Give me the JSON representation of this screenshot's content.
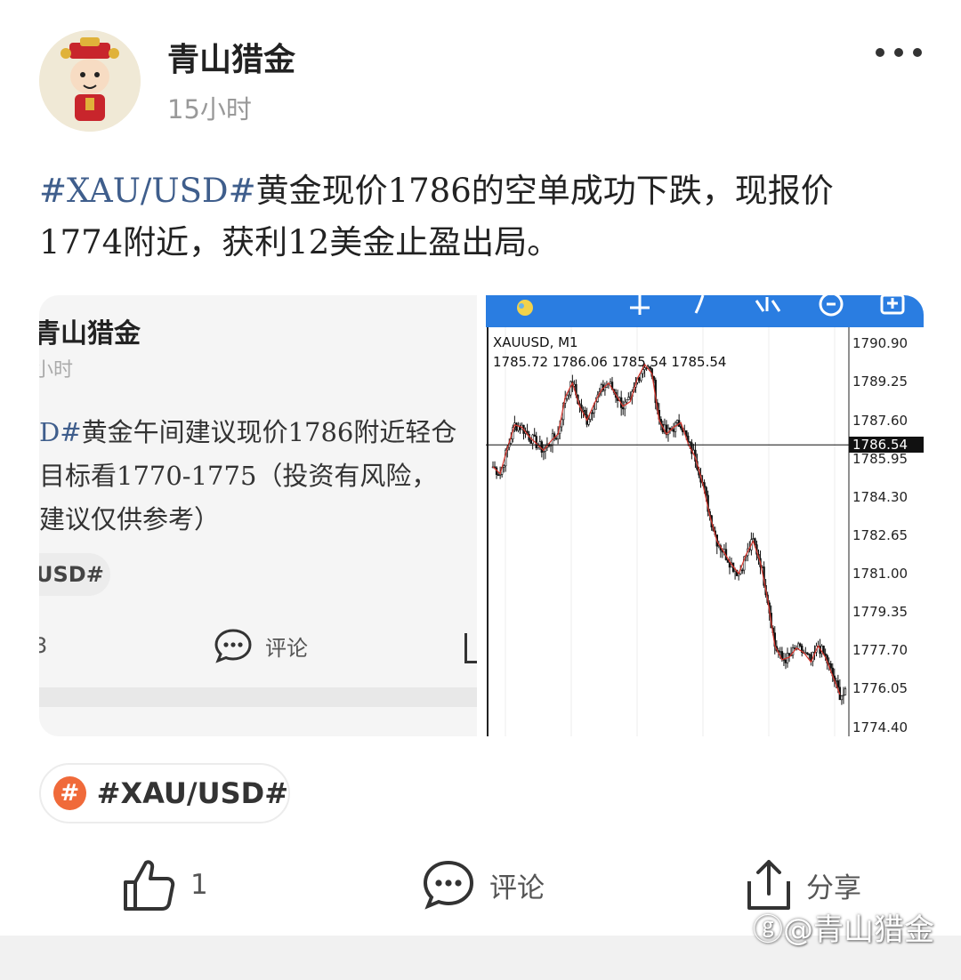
{
  "post": {
    "author": "青山猎金",
    "time": "15小时",
    "text_hashtag": "#XAU/USD#",
    "text_body_line1": "黄金现价1786的空单成功下跌，现报价",
    "text_body_line2": "1774附近，获利12美金止盈出局。"
  },
  "quoted_screenshot": {
    "author": "青山猎金",
    "time": "小时",
    "line1_hashtag": "D#",
    "line1_text": "黄金午间建议现价1786附近轻仓",
    "line2_text": "目标看1770-1775（投资有风险，",
    "line3_text": "建议仅供参考）",
    "tag_label": "USD#",
    "action_left": "3",
    "comment_label": "评论"
  },
  "chart_data": {
    "type": "candlestick",
    "symbol": "XAUUSD, M1",
    "quote": "1785.72 1786.06 1785.54 1785.54",
    "y_ticks": [
      "1790.90",
      "1789.25",
      "1787.60",
      "1785.95",
      "1784.30",
      "1782.65",
      "1781.00",
      "1779.35",
      "1777.70",
      "1776.05",
      "1774.40"
    ],
    "ylim": [
      1774.0,
      1791.6
    ],
    "current_price": 1786.54,
    "current_price_label": "1786.54",
    "close_path_approx": [
      1785.6,
      1785.3,
      1786.4,
      1787.4,
      1787.3,
      1786.9,
      1786.6,
      1786.3,
      1786.7,
      1787.0,
      1788.6,
      1789.2,
      1788.2,
      1787.6,
      1788.3,
      1788.9,
      1789.2,
      1788.7,
      1788.2,
      1788.4,
      1789.4,
      1790.0,
      1789.6,
      1787.6,
      1787.0,
      1787.3,
      1787.5,
      1786.6,
      1786.0,
      1784.9,
      1783.5,
      1782.4,
      1781.9,
      1781.4,
      1781.0,
      1781.8,
      1782.4,
      1781.5,
      1779.9,
      1777.9,
      1777.3,
      1777.4,
      1777.8,
      1777.6,
      1777.2,
      1777.9,
      1777.4,
      1776.6,
      1775.8
    ]
  },
  "topic_chip": {
    "icon": "#",
    "label": "#XAU/USD#"
  },
  "actions": {
    "like_count": "1",
    "comment_label": "评论",
    "share_label": "分享"
  },
  "watermark": "@青山猎金",
  "colors": {
    "hashtag": "#3f5e8c",
    "toolbar": "#2a7de1",
    "ma_line": "#d9342b",
    "topic_icon": "#f06a3a"
  }
}
